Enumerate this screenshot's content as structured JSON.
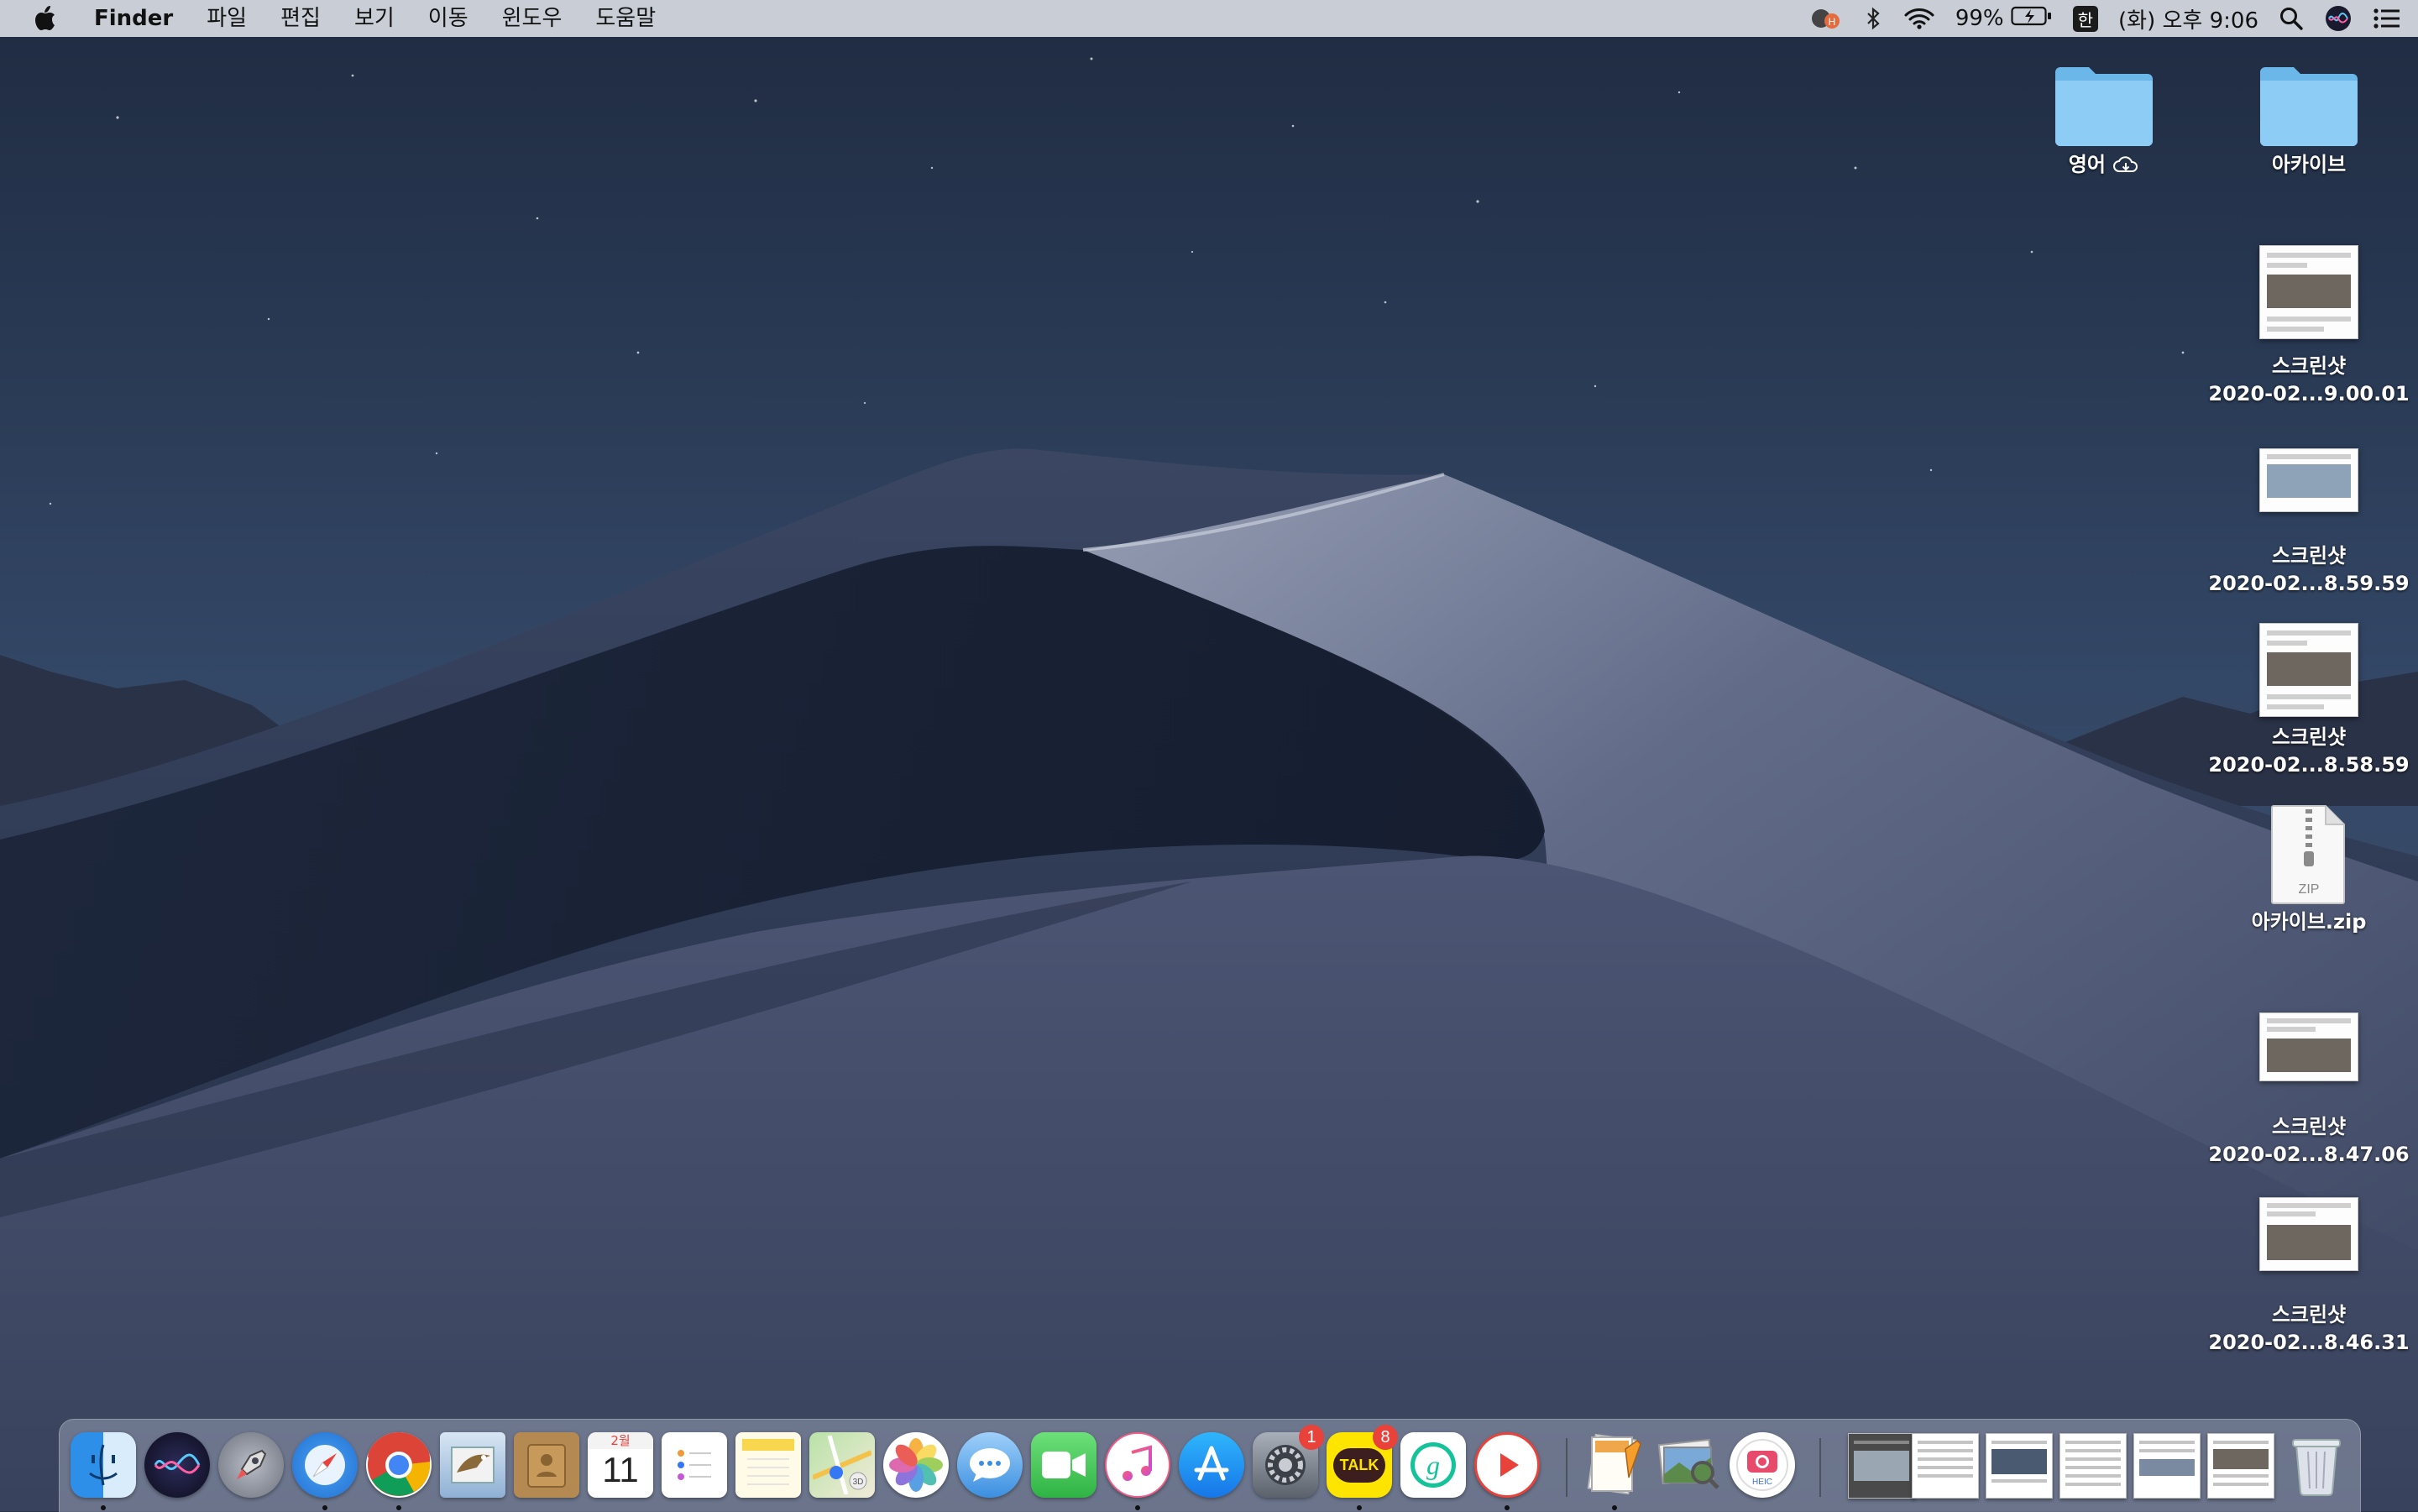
{
  "menubar": {
    "apple_icon": "apple-logo-icon",
    "app_name": "Finder",
    "menus": [
      "파일",
      "편집",
      "보기",
      "이동",
      "윈도우",
      "도움말"
    ],
    "status": {
      "battery": "99%",
      "input_source": "한",
      "clock": "(화) 오후 9:06"
    }
  },
  "desktop": {
    "icons": [
      {
        "label": "영어",
        "kind": "folder",
        "cloud": true
      },
      {
        "label": "아카이브",
        "kind": "folder"
      },
      {
        "line1": "스크린샷",
        "line2": "2020-02...9.00.01",
        "kind": "screenshot"
      },
      {
        "line1": "스크린샷",
        "line2": "2020-02...8.59.59",
        "kind": "screenshot"
      },
      {
        "line1": "스크린샷",
        "line2": "2020-02...8.58.59",
        "kind": "screenshot"
      },
      {
        "label": "아카이브.zip",
        "kind": "zip",
        "badge": "ZIP"
      },
      {
        "line1": "스크린샷",
        "line2": "2020-02...8.47.06",
        "kind": "screenshot"
      },
      {
        "line1": "스크린샷",
        "line2": "2020-02...8.46.31",
        "kind": "screenshot"
      }
    ]
  },
  "dock": {
    "apps": [
      {
        "name": "finder-icon",
        "running": true
      },
      {
        "name": "siri-icon"
      },
      {
        "name": "launchpad-icon"
      },
      {
        "name": "safari-icon",
        "running": true
      },
      {
        "name": "chrome-icon",
        "running": true
      },
      {
        "name": "mail-icon"
      },
      {
        "name": "contacts-icon"
      },
      {
        "name": "calendar-icon",
        "month": "2월",
        "day": "11"
      },
      {
        "name": "reminders-icon"
      },
      {
        "name": "notes-icon"
      },
      {
        "name": "maps-icon"
      },
      {
        "name": "photos-icon"
      },
      {
        "name": "messages-icon"
      },
      {
        "name": "facetime-icon"
      },
      {
        "name": "itunes-icon",
        "running": true
      },
      {
        "name": "app-store-icon"
      },
      {
        "name": "system-preferences-icon",
        "badge": "1"
      },
      {
        "name": "kakaotalk-icon",
        "label": "TALK",
        "badge": "8",
        "running": true
      },
      {
        "name": "grammarly-icon"
      },
      {
        "name": "player-icon",
        "running": true
      },
      {
        "name": "pages-icon",
        "running": true
      },
      {
        "name": "preview-icon"
      },
      {
        "name": "photo-booth-icon",
        "label": "HEIC"
      }
    ],
    "trash": "trash-icon"
  }
}
